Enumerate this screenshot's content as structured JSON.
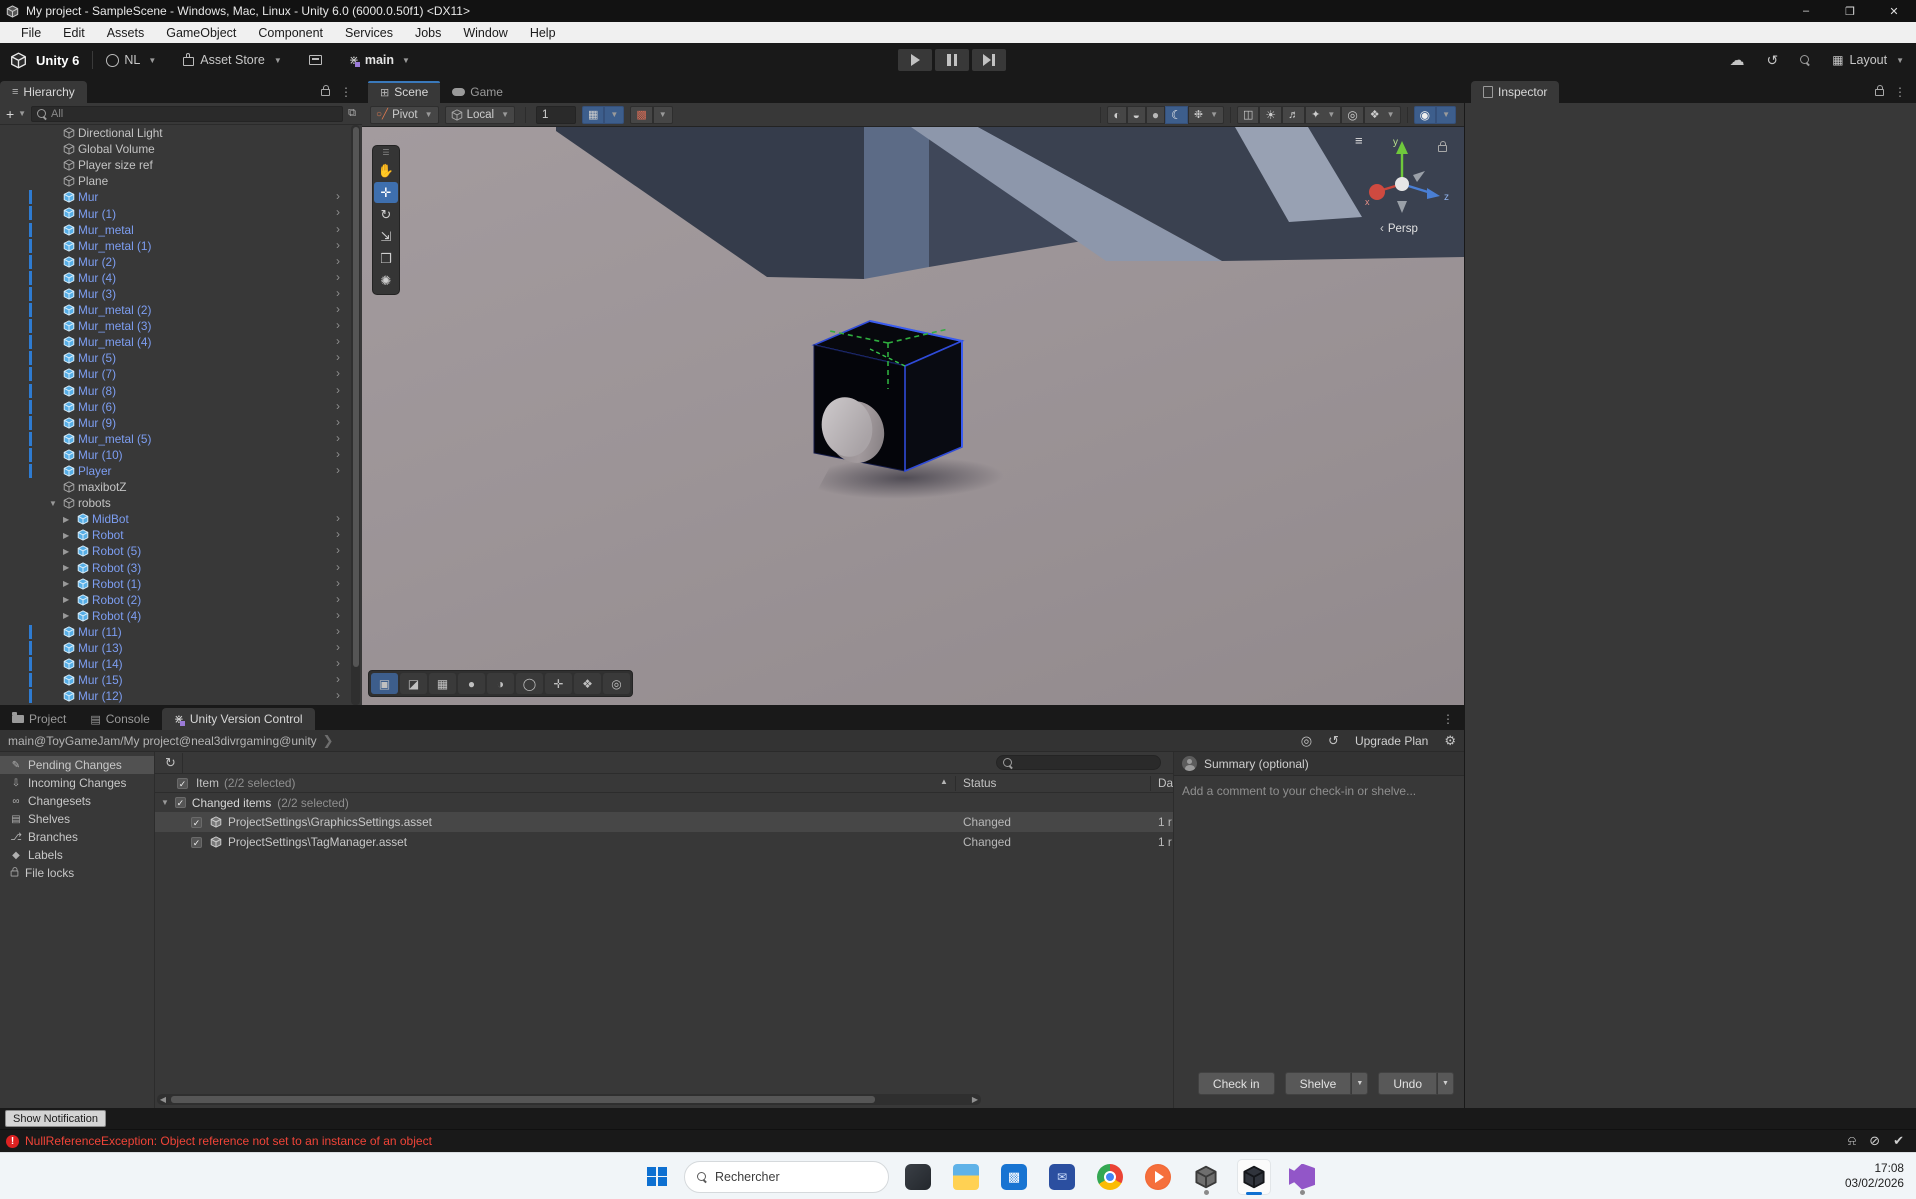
{
  "window": {
    "title": "My project - SampleScene - Windows, Mac, Linux - Unity 6.0 (6000.0.50f1) <DX11>"
  },
  "menu": {
    "items": [
      "File",
      "Edit",
      "Assets",
      "GameObject",
      "Component",
      "Services",
      "Jobs",
      "Window",
      "Help"
    ]
  },
  "toolbar": {
    "product": "Unity 6",
    "account": "NL",
    "asset_store": "Asset Store",
    "branch": "main",
    "layout": "Layout"
  },
  "hierarchy": {
    "tab": "Hierarchy",
    "search_placeholder": "All",
    "items": [
      {
        "label": "Directional Light",
        "type": "plain"
      },
      {
        "label": "Global Volume",
        "type": "plain"
      },
      {
        "label": "Player size ref",
        "type": "plain"
      },
      {
        "label": "Plane",
        "type": "plain"
      },
      {
        "label": "Mur",
        "type": "prefab",
        "bar": true,
        "chevron": true
      },
      {
        "label": "Mur (1)",
        "type": "prefab",
        "bar": true,
        "chevron": true
      },
      {
        "label": "Mur_metal",
        "type": "prefab",
        "bar": true,
        "chevron": true
      },
      {
        "label": "Mur_metal (1)",
        "type": "prefab",
        "bar": true,
        "chevron": true
      },
      {
        "label": "Mur (2)",
        "type": "prefab",
        "bar": true,
        "chevron": true
      },
      {
        "label": "Mur (4)",
        "type": "prefab",
        "bar": true,
        "chevron": true
      },
      {
        "label": "Mur (3)",
        "type": "prefab",
        "bar": true,
        "chevron": true
      },
      {
        "label": "Mur_metal (2)",
        "type": "prefab",
        "bar": true,
        "chevron": true
      },
      {
        "label": "Mur_metal (3)",
        "type": "prefab",
        "bar": true,
        "chevron": true
      },
      {
        "label": "Mur_metal (4)",
        "type": "prefab",
        "bar": true,
        "chevron": true
      },
      {
        "label": "Mur (5)",
        "type": "prefab",
        "bar": true,
        "chevron": true
      },
      {
        "label": "Mur (7)",
        "type": "prefab",
        "bar": true,
        "chevron": true
      },
      {
        "label": "Mur (8)",
        "type": "prefab",
        "bar": true,
        "chevron": true
      },
      {
        "label": "Mur (6)",
        "type": "prefab",
        "bar": true,
        "chevron": true
      },
      {
        "label": "Mur (9)",
        "type": "prefab",
        "bar": true,
        "chevron": true
      },
      {
        "label": "Mur_metal (5)",
        "type": "prefab",
        "bar": true,
        "chevron": true
      },
      {
        "label": "Mur (10)",
        "type": "prefab",
        "bar": true,
        "chevron": true
      },
      {
        "label": "Player",
        "type": "prefab",
        "bar": true,
        "chevron": true
      },
      {
        "label": "maxibotZ",
        "type": "plain"
      },
      {
        "label": "robots",
        "type": "plain",
        "arrow": "down"
      },
      {
        "label": "MidBot",
        "type": "prefab",
        "indent": 1,
        "arrow": "right",
        "chevron": true
      },
      {
        "label": "Robot",
        "type": "prefab",
        "indent": 1,
        "arrow": "right",
        "chevron": true
      },
      {
        "label": "Robot (5)",
        "type": "prefab",
        "indent": 1,
        "arrow": "right",
        "chevron": true
      },
      {
        "label": "Robot (3)",
        "type": "prefab",
        "indent": 1,
        "arrow": "right",
        "chevron": true
      },
      {
        "label": "Robot (1)",
        "type": "prefab",
        "indent": 1,
        "arrow": "right",
        "chevron": true
      },
      {
        "label": "Robot (2)",
        "type": "prefab",
        "indent": 1,
        "arrow": "right",
        "chevron": true
      },
      {
        "label": "Robot (4)",
        "type": "prefab",
        "indent": 1,
        "arrow": "right",
        "chevron": true
      },
      {
        "label": "Mur (11)",
        "type": "prefab",
        "bar": true,
        "chevron": true
      },
      {
        "label": "Mur (13)",
        "type": "prefab",
        "bar": true,
        "chevron": true
      },
      {
        "label": "Mur (14)",
        "type": "prefab",
        "bar": true,
        "chevron": true
      },
      {
        "label": "Mur (15)",
        "type": "prefab",
        "bar": true,
        "chevron": true
      },
      {
        "label": "Mur (12)",
        "type": "prefab",
        "bar": true,
        "chevron": true
      }
    ]
  },
  "scene": {
    "tab_scene": "Scene",
    "tab_game": "Game",
    "pivot": "Pivot",
    "orientation": "Local",
    "snap_value": "1",
    "persp": "Persp",
    "gizmo_axes": {
      "y": "y",
      "z": "z",
      "x": "x"
    }
  },
  "inspector": {
    "tab": "Inspector"
  },
  "vcs": {
    "tab_project": "Project",
    "tab_console": "Console",
    "tab_vcs": "Unity Version Control",
    "workspace": "main@ToyGameJam/My project@neal3divrgaming@unity",
    "upgrade": "Upgrade Plan",
    "nav": [
      {
        "label": "Pending Changes",
        "icon": "pending",
        "selected": true
      },
      {
        "label": "Incoming Changes",
        "icon": "incoming"
      },
      {
        "label": "Changesets",
        "icon": "changesets"
      },
      {
        "label": "Shelves",
        "icon": "shelves"
      },
      {
        "label": "Branches",
        "icon": "branches"
      },
      {
        "label": "Labels",
        "icon": "labels"
      },
      {
        "label": "File locks",
        "icon": "lock"
      }
    ],
    "table": {
      "item_header": "Item",
      "item_count": "(2/2 selected)",
      "status_header": "Status",
      "date_header": "Da",
      "group_label": "Changed items",
      "group_count": "(2/2 selected)",
      "rows": [
        {
          "name": "ProjectSettings\\GraphicsSettings.asset",
          "status": "Changed",
          "date": "1 r",
          "highlight": true
        },
        {
          "name": "ProjectSettings\\TagManager.asset",
          "status": "Changed",
          "date": "1 r",
          "highlight": false
        }
      ]
    },
    "summary": {
      "title": "Summary (optional)",
      "placeholder": "Add a comment to your check-in or shelve...",
      "check_in": "Check in",
      "shelve": "Shelve",
      "undo": "Undo"
    }
  },
  "status": {
    "show_notification": "Show Notification",
    "error": "NullReferenceException: Object reference not set to an instance of an object"
  },
  "taskbar": {
    "search_placeholder": "Rechercher",
    "time": "17:08",
    "date": "03/02/2026"
  }
}
